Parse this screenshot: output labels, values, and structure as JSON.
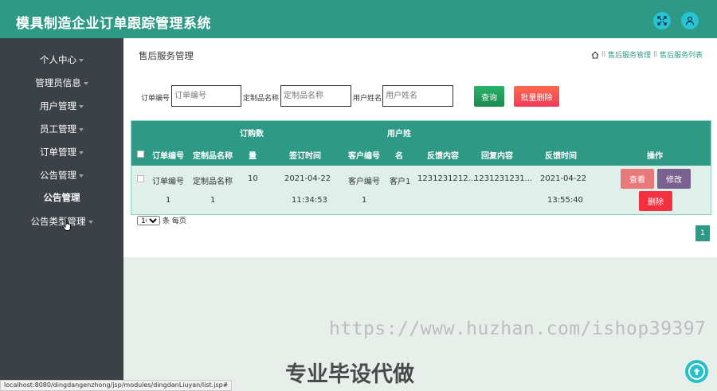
{
  "app": {
    "title": "模具制造企业订单跟踪管理系统"
  },
  "topbar": {
    "icons": [
      "fullscreen-icon",
      "user-icon"
    ],
    "accent_color": "#2e9a86"
  },
  "sidebar": {
    "items": [
      {
        "label": "个人中心",
        "has_caret": true
      },
      {
        "label": "管理员信息",
        "has_caret": true
      },
      {
        "label": "用户管理",
        "has_caret": true
      },
      {
        "label": "员工管理",
        "has_caret": true
      },
      {
        "label": "订单管理",
        "has_caret": true
      },
      {
        "label": "公告管理",
        "has_caret": true
      },
      {
        "label": "公告管理",
        "has_caret": false,
        "sub": true
      },
      {
        "label": "公告类型管理",
        "has_caret": true
      }
    ]
  },
  "page": {
    "title": "售后服务管理",
    "breadcrumb": [
      "售后服务管理",
      "售后服务列表"
    ],
    "breadcrumb_sep": "ll"
  },
  "search": {
    "order_no_label": "订单编号",
    "order_no_placeholder": "订单编号",
    "product_label": "定制品名称",
    "product_placeholder": "定制品名称",
    "username_label": "用户姓名",
    "username_placeholder": "用户姓名",
    "query_label": "查询",
    "batch_delete_label": "批量删除"
  },
  "table": {
    "headers": {
      "order_no": "订单编号",
      "product": "定制品名称",
      "qty_line1": "订购数",
      "qty_line2": "量",
      "sign_time": "签订时间",
      "customer_no": "客户编号",
      "username_line1": "用户姓",
      "username_line2": "名",
      "feedback": "反馈内容",
      "reply": "回复内容",
      "feedback_time": "反馈时间",
      "actions": "操作"
    },
    "rows": [
      {
        "order_no_1": "订单编号",
        "order_no_2": "1",
        "product_1": "定制品名称",
        "product_2": "1",
        "qty": "10",
        "sign_time_1": "2021-04-22",
        "sign_time_2": "11:34:53",
        "customer_no_1": "客户编号",
        "customer_no_2": "1",
        "username": "客户1",
        "feedback": "1231231212...",
        "reply": "1231231231...",
        "feedback_time_1": "2021-04-22",
        "feedback_time_2": "13:55:40",
        "view_label": "查看",
        "edit_label": "修改",
        "delete_label": "删除"
      }
    ]
  },
  "pagination": {
    "page_size": "10",
    "page_size_suffix": "条 每页",
    "current_page": "1"
  },
  "overlay": {
    "watermark_url": "https://www.huzhan.com/ishop39397",
    "watermark_text": "专业毕设代做",
    "status_url": "localhost:8080/dingdangenzhong/jsp/modules/dingdanLiuyan/list.jsp#"
  }
}
